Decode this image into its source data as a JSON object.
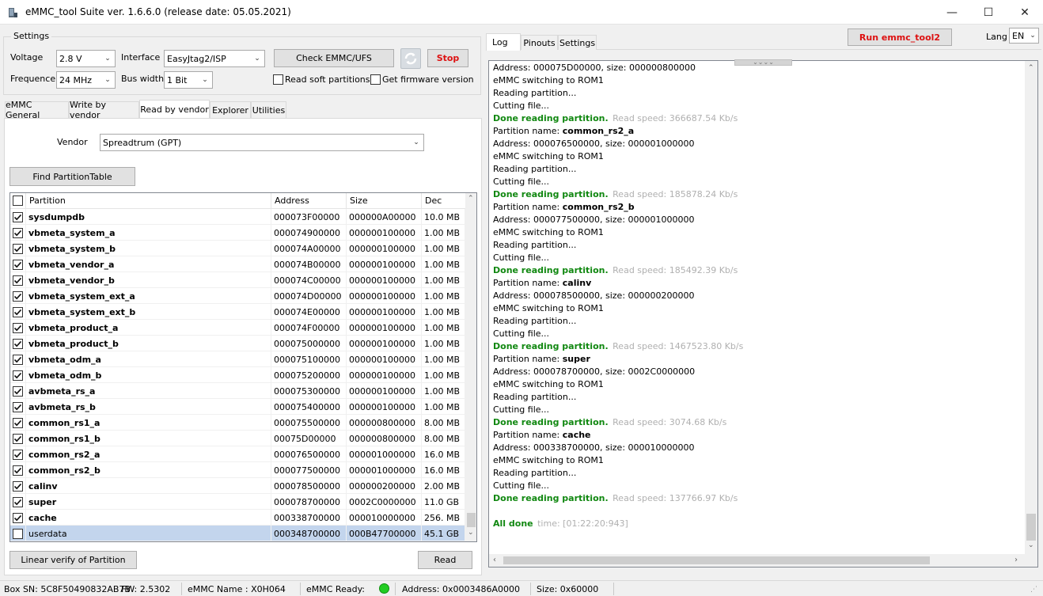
{
  "window": {
    "title": "eMMC_tool Suite  ver. 1.6.6.0 (release date: 05.05.2021)",
    "minimize_glyph": "—",
    "maximize_glyph": "☐",
    "close_glyph": "✕"
  },
  "settings": {
    "group_label": "Settings",
    "voltage_label": "Voltage",
    "voltage_value": "2.8 V",
    "interface_label": "Interface",
    "interface_value": "EasyJtag2/ISP",
    "frequence_label": "Frequence",
    "frequence_value": "24 MHz",
    "buswidth_label": "Bus width",
    "buswidth_value": "1 Bit",
    "check_button": "Check EMMC/UFS",
    "stop_button": "Stop",
    "read_soft_label": "Read soft partitions",
    "get_fw_label": "Get firmware version"
  },
  "left_tabs": [
    "eMMC General",
    "Write by vendor",
    "Read by vendor",
    "Explorer",
    "Utilities"
  ],
  "vendor": {
    "label": "Vendor",
    "value": "Spreadtrum (GPT)"
  },
  "find_button": "Find PartitionTable",
  "table": {
    "columns": [
      "Partition",
      "Address",
      "Size",
      "Dec"
    ],
    "rows": [
      {
        "name": "sysdumpdb",
        "address": "000073F00000",
        "size": "000000A00000",
        "dec": "10.0 MB",
        "checked": true
      },
      {
        "name": "vbmeta_system_a",
        "address": "000074900000",
        "size": "000000100000",
        "dec": "1.00 MB",
        "checked": true
      },
      {
        "name": "vbmeta_system_b",
        "address": "000074A00000",
        "size": "000000100000",
        "dec": "1.00 MB",
        "checked": true
      },
      {
        "name": "vbmeta_vendor_a",
        "address": "000074B00000",
        "size": "000000100000",
        "dec": "1.00 MB",
        "checked": true
      },
      {
        "name": "vbmeta_vendor_b",
        "address": "000074C00000",
        "size": "000000100000",
        "dec": "1.00 MB",
        "checked": true
      },
      {
        "name": "vbmeta_system_ext_a",
        "address": "000074D00000",
        "size": "000000100000",
        "dec": "1.00 MB",
        "checked": true
      },
      {
        "name": "vbmeta_system_ext_b",
        "address": "000074E00000",
        "size": "000000100000",
        "dec": "1.00 MB",
        "checked": true
      },
      {
        "name": "vbmeta_product_a",
        "address": "000074F00000",
        "size": "000000100000",
        "dec": "1.00 MB",
        "checked": true
      },
      {
        "name": "vbmeta_product_b",
        "address": "000075000000",
        "size": "000000100000",
        "dec": "1.00 MB",
        "checked": true
      },
      {
        "name": "vbmeta_odm_a",
        "address": "000075100000",
        "size": "000000100000",
        "dec": "1.00 MB",
        "checked": true
      },
      {
        "name": "vbmeta_odm_b",
        "address": "000075200000",
        "size": "000000100000",
        "dec": "1.00 MB",
        "checked": true
      },
      {
        "name": "avbmeta_rs_a",
        "address": "000075300000",
        "size": "000000100000",
        "dec": "1.00 MB",
        "checked": true
      },
      {
        "name": "avbmeta_rs_b",
        "address": "000075400000",
        "size": "000000100000",
        "dec": "1.00 MB",
        "checked": true
      },
      {
        "name": "common_rs1_a",
        "address": "000075500000",
        "size": "000000800000",
        "dec": "8.00 MB",
        "checked": true
      },
      {
        "name": "common_rs1_b",
        "address": "00075D00000",
        "size": "000000800000",
        "dec": "8.00 MB",
        "checked": true
      },
      {
        "name": "common_rs2_a",
        "address": "000076500000",
        "size": "000001000000",
        "dec": "16.0 MB",
        "checked": true
      },
      {
        "name": "common_rs2_b",
        "address": "000077500000",
        "size": "000001000000",
        "dec": "16.0 MB",
        "checked": true
      },
      {
        "name": "calinv",
        "address": "000078500000",
        "size": "000000200000",
        "dec": "2.00 MB",
        "checked": true
      },
      {
        "name": "super",
        "address": "000078700000",
        "size": "0002C0000000",
        "dec": "11.0 GB",
        "checked": true
      },
      {
        "name": "cache",
        "address": "000338700000",
        "size": "000010000000",
        "dec": "256. MB",
        "checked": true
      },
      {
        "name": "userdata",
        "address": "000348700000",
        "size": "000B47700000",
        "dec": "45.1 GB",
        "checked": false,
        "selected": true
      }
    ]
  },
  "linear_verify_button": "Linear verify of Partition",
  "read_button": "Read",
  "right_tabs": [
    "Log",
    "Pinouts",
    "Settings"
  ],
  "run_button": "Run emmc_tool2",
  "lang": {
    "label": "Lang",
    "value": "EN"
  },
  "log": {
    "lines": [
      {
        "t": "Address: 000075D00000, size: 000000800000"
      },
      {
        "t": "eMMC switching to ROM1"
      },
      {
        "t": "Reading partition..."
      },
      {
        "t": "Cutting file..."
      },
      {
        "done": "Done reading partition.",
        "speed": "Read speed: 366687.54 Kb/s"
      },
      {
        "label": "Partition name: ",
        "bold": "common_rs2_a"
      },
      {
        "t": "Address: 000076500000, size: 000001000000"
      },
      {
        "t": "eMMC switching to ROM1"
      },
      {
        "t": "Reading partition..."
      },
      {
        "t": "Cutting file..."
      },
      {
        "done": "Done reading partition.",
        "speed": "Read speed: 185878.24 Kb/s"
      },
      {
        "label": "Partition name: ",
        "bold": "common_rs2_b"
      },
      {
        "t": "Address: 000077500000, size: 000001000000"
      },
      {
        "t": "eMMC switching to ROM1"
      },
      {
        "t": "Reading partition..."
      },
      {
        "t": "Cutting file..."
      },
      {
        "done": "Done reading partition.",
        "speed": "Read speed: 185492.39 Kb/s"
      },
      {
        "label": "Partition name: ",
        "bold": "calinv"
      },
      {
        "t": "Address: 000078500000, size: 000000200000"
      },
      {
        "t": "eMMC switching to ROM1"
      },
      {
        "t": "Reading partition..."
      },
      {
        "t": "Cutting file..."
      },
      {
        "done": "Done reading partition.",
        "speed": "Read speed: 1467523.80 Kb/s"
      },
      {
        "label": "Partition name: ",
        "bold": "super"
      },
      {
        "t": "Address: 000078700000, size: 0002C0000000"
      },
      {
        "t": "eMMC switching to ROM1"
      },
      {
        "t": "Reading partition..."
      },
      {
        "t": "Cutting file..."
      },
      {
        "done": "Done reading partition.",
        "speed": "Read speed: 3074.68 Kb/s"
      },
      {
        "label": "Partition name: ",
        "bold": "cache"
      },
      {
        "t": "Address: 000338700000, size: 000010000000"
      },
      {
        "t": "eMMC switching to ROM1"
      },
      {
        "t": "Reading partition..."
      },
      {
        "t": "Cutting file..."
      },
      {
        "done": "Done reading partition.",
        "speed": "Read speed: 137766.97 Kb/s"
      },
      {
        "blank": true
      },
      {
        "done": "All done",
        "speed": "time: [01:22:20:943]"
      }
    ]
  },
  "statusbar": {
    "box_sn": "Box SN:  5C8F50490832AB7B",
    "fw": "FW:  2.5302",
    "emmc_name": "eMMC Name : X0H064",
    "emmc_ready": "eMMC Ready:",
    "address": "Address: 0x0003486A0000",
    "size": "Size: 0x60000"
  },
  "colors": {
    "stop_text": "#dd1111",
    "run_text": "#dd1111",
    "done_green": "#118811",
    "selection": "#c3d5ed",
    "ready_led": "#22cc22"
  }
}
